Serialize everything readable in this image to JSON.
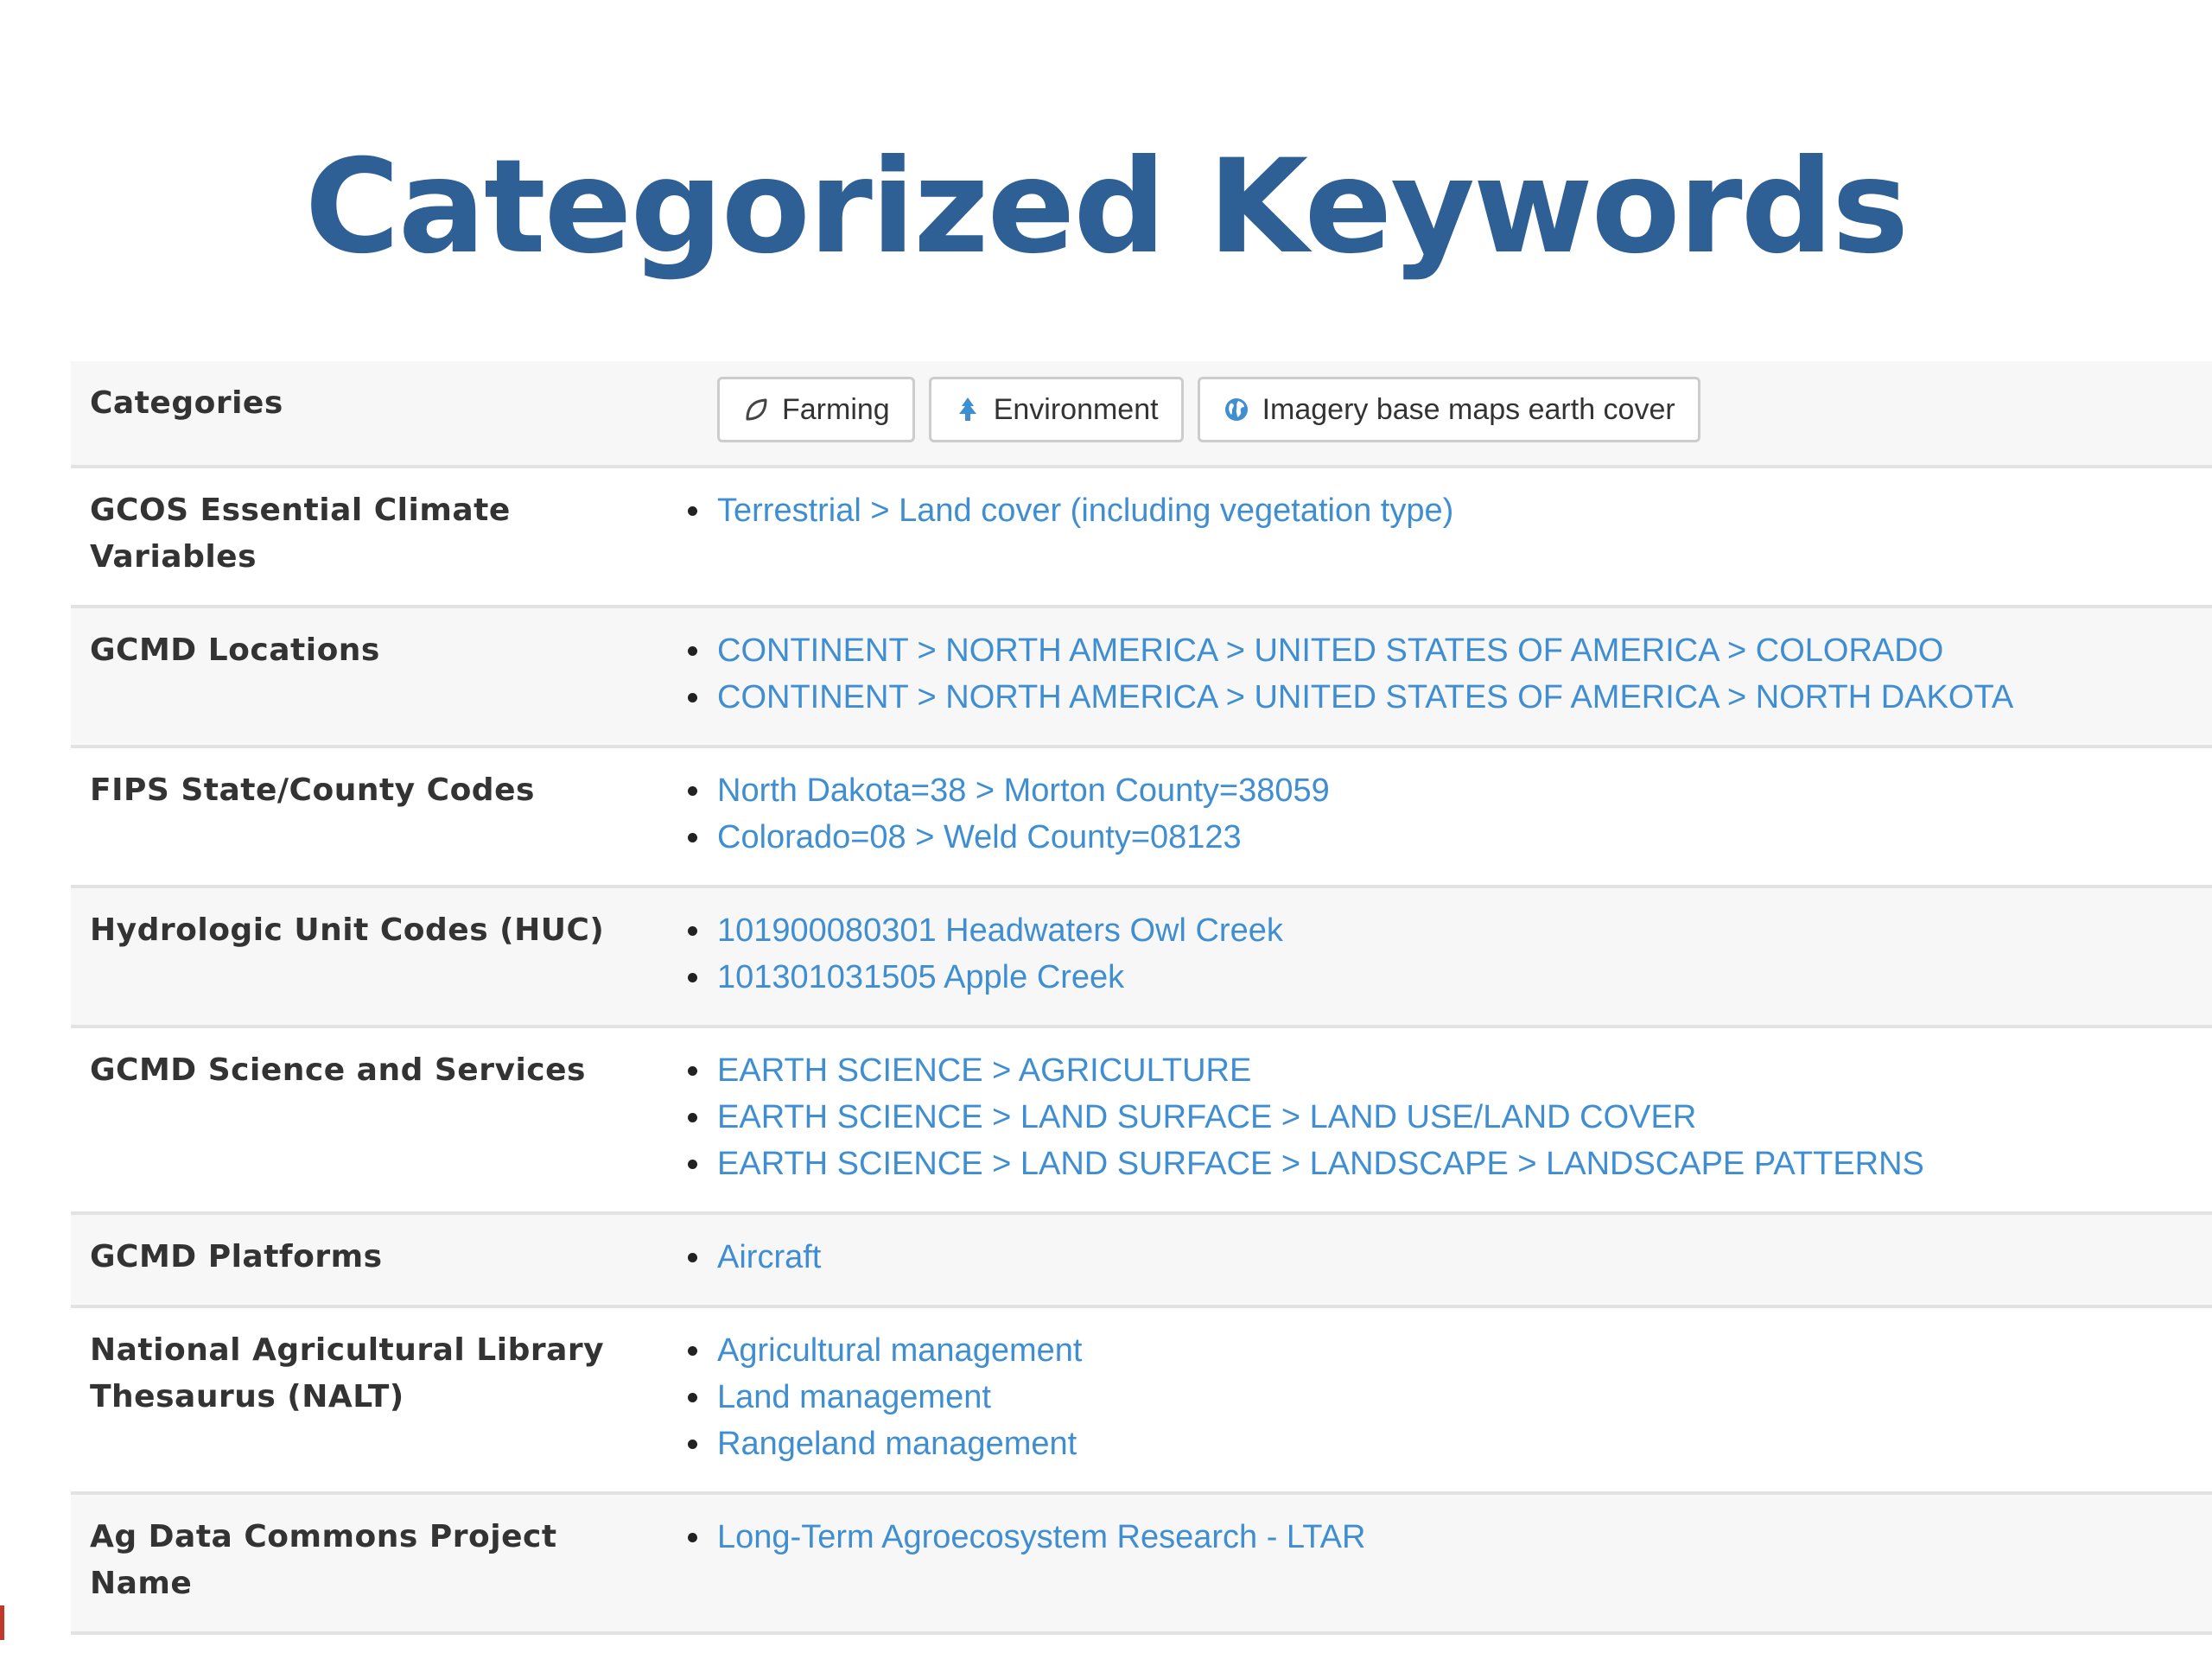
{
  "slide": {
    "title": "Categorized Keywords"
  },
  "categories_row": {
    "label": "Categories",
    "buttons": [
      {
        "label": "Farming",
        "icon": "leaf-icon"
      },
      {
        "label": "Environment",
        "icon": "tree-icon"
      },
      {
        "label": "Imagery base maps earth cover",
        "icon": "globe-icon"
      }
    ]
  },
  "rows": [
    {
      "label": "GCOS Essential Climate Variables",
      "items": [
        "Terrestrial > Land cover (including vegetation type)"
      ]
    },
    {
      "label": "GCMD Locations",
      "items": [
        "CONTINENT > NORTH AMERICA > UNITED STATES OF AMERICA > COLORADO",
        "CONTINENT > NORTH AMERICA > UNITED STATES OF AMERICA > NORTH DAKOTA"
      ]
    },
    {
      "label": "FIPS State/County Codes",
      "items": [
        "North Dakota=38 > Morton County=38059",
        "Colorado=08 > Weld County=08123"
      ]
    },
    {
      "label": "Hydrologic Unit Codes (HUC)",
      "items": [
        "101900080301 Headwaters Owl Creek",
        "101301031505 Apple Creek"
      ]
    },
    {
      "label": "GCMD Science and Services",
      "items": [
        "EARTH SCIENCE > AGRICULTURE",
        "EARTH SCIENCE > LAND SURFACE > LAND USE/LAND COVER",
        "EARTH SCIENCE > LAND SURFACE > LANDSCAPE > LANDSCAPE PATTERNS"
      ]
    },
    {
      "label": "GCMD Platforms",
      "items": [
        "Aircraft"
      ]
    },
    {
      "label": "National Agricultural Library Thesaurus (NALT)",
      "items": [
        "Agricultural management",
        "Land management",
        "Rangeland management"
      ]
    },
    {
      "label": "Ag Data Commons Project Name",
      "items": [
        "Long-Term Agroecosystem Research - LTAR"
      ]
    }
  ],
  "colors": {
    "title": "#2e5f95",
    "link": "#3f8ed1",
    "label": "#333333",
    "row_shade": "#f7f7f7",
    "divider": "#e2e2e2"
  }
}
